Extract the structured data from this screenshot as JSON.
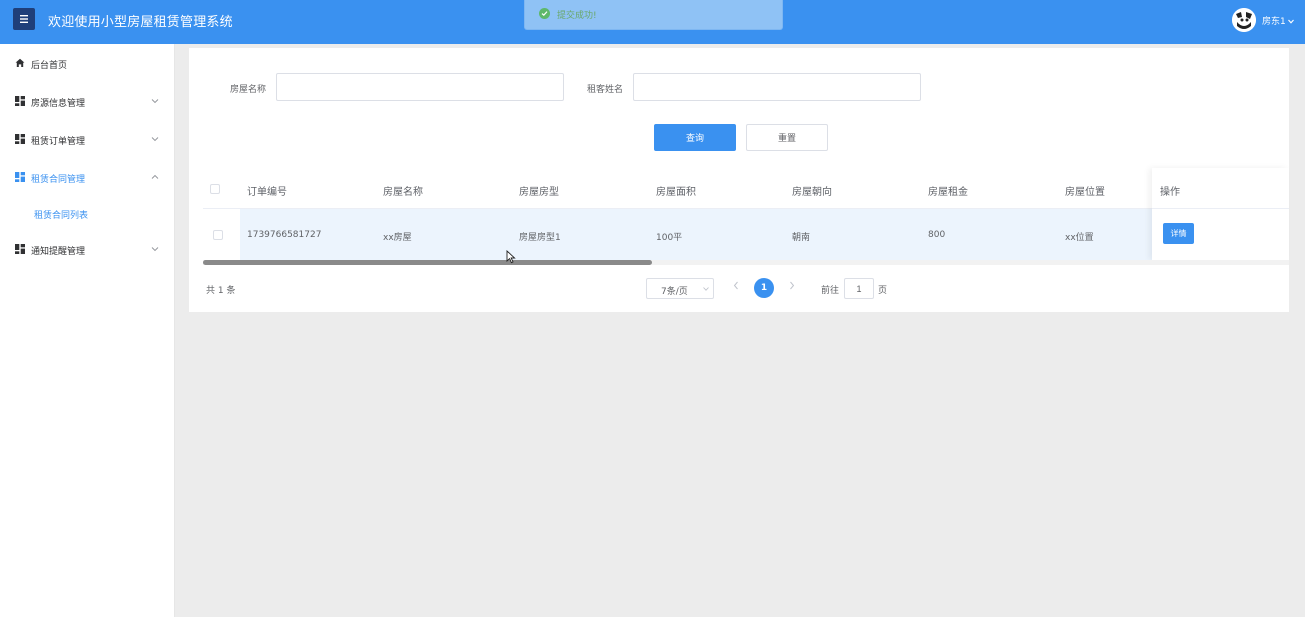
{
  "header": {
    "title": "欢迎使用小型房屋租赁管理系统",
    "user_name": "房东1"
  },
  "toast": {
    "message": "提交成功!"
  },
  "sidebar": {
    "items": [
      {
        "label": "后台首页"
      },
      {
        "label": "房源信息管理"
      },
      {
        "label": "租赁订单管理"
      },
      {
        "label": "租赁合同管理"
      },
      {
        "label": "通知提醒管理"
      }
    ],
    "sub_item": {
      "label": "租赁合同列表"
    }
  },
  "search": {
    "house_name_label": "房屋名称",
    "house_name_value": "",
    "tenant_name_label": "租客姓名",
    "tenant_name_value": "",
    "query_label": "查询",
    "reset_label": "重置"
  },
  "table": {
    "columns": [
      "订单编号",
      "房屋名称",
      "房屋房型",
      "房屋面积",
      "房屋朝向",
      "房屋租金",
      "房屋位置",
      "操作"
    ],
    "rows": [
      {
        "order_no": "1739766581727",
        "house_name": "xx房屋",
        "house_type": "房屋房型1",
        "area": "100平",
        "orientation": "朝南",
        "rent": "800",
        "location": "xx位置",
        "action": "详情"
      }
    ]
  },
  "pagination": {
    "total_text": "共 1 条",
    "page_size": "7条/页",
    "current_page": "1",
    "goto_label": "前往",
    "goto_value": "1",
    "page_suffix": "页"
  },
  "colors": {
    "primary": "#3a91f0",
    "header_bg": "#3a91f0",
    "toggle_bg": "#1f3f7a",
    "row_highlight": "#ecf4fd",
    "toast_bg": "#8fc2f5",
    "success": "#5eb86a"
  },
  "icons": {
    "menu_toggle": "hamburger-icon",
    "home": "home-icon",
    "module": "grid-icon",
    "expand": "chevron-down-icon",
    "collapse": "chevron-up-icon",
    "toast": "check-circle-icon"
  }
}
